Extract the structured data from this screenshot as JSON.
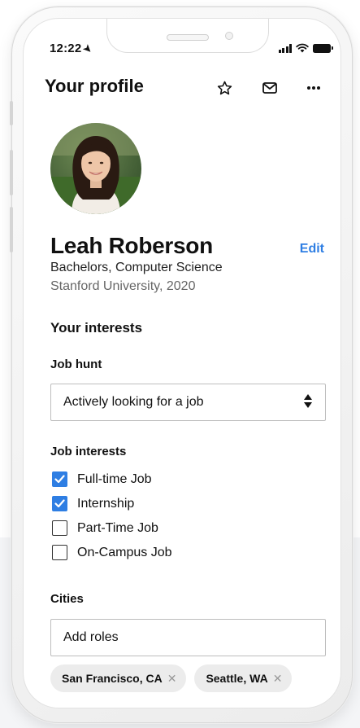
{
  "status_bar": {
    "time": "12:22"
  },
  "header": {
    "title": "Your profile"
  },
  "profile": {
    "name": "Leah Roberson",
    "edit_label": "Edit",
    "degree": "Bachelors, Computer Science",
    "school": "Stanford University, 2020"
  },
  "interests": {
    "title": "Your interests",
    "job_hunt": {
      "label": "Job hunt",
      "selected": "Actively looking for a job"
    },
    "job_interests": {
      "label": "Job interests",
      "options": [
        {
          "label": "Full-time Job",
          "checked": true
        },
        {
          "label": "Internship",
          "checked": true
        },
        {
          "label": "Part-Time Job",
          "checked": false
        },
        {
          "label": "On-Campus Job",
          "checked": false
        }
      ]
    },
    "cities": {
      "label": "Cities",
      "input_value": "Add roles",
      "chips": [
        "San Francisco, CA",
        "Seattle, WA"
      ]
    }
  },
  "colors": {
    "accent": "#2e7ee3",
    "chip_bg": "#ececec"
  }
}
